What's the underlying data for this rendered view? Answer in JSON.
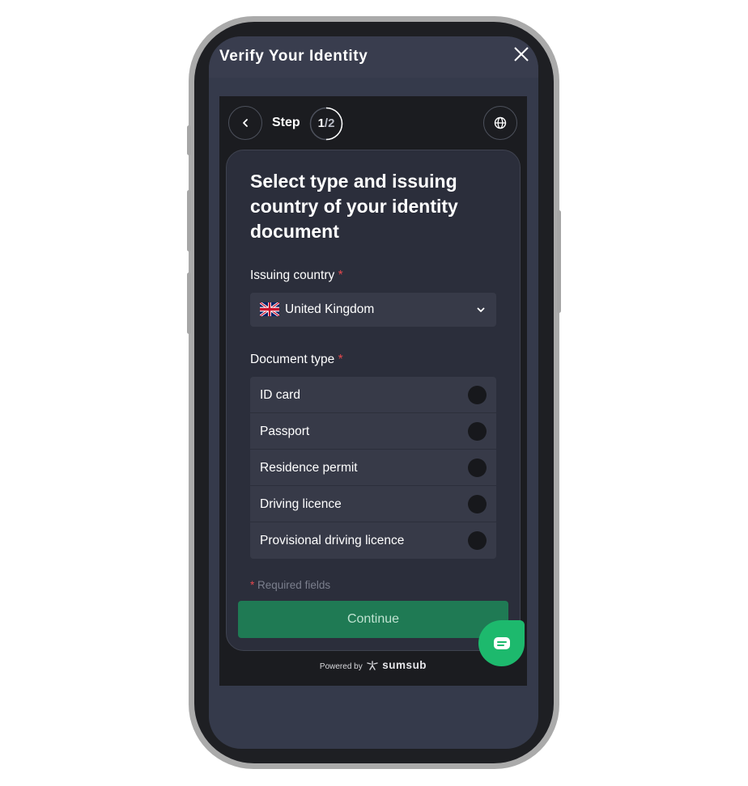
{
  "header": {
    "title": "Verify Your Identity",
    "close_icon": "close-icon"
  },
  "stepper": {
    "back_icon": "chevron-left-icon",
    "label": "Step",
    "current": "1",
    "total": "2",
    "progress": 0.5,
    "language_icon": "globe-icon"
  },
  "form": {
    "title": "Select type and issuing country of your identity document",
    "country_label": "Issuing country",
    "required_mark": "*",
    "country_value": "United Kingdom",
    "country_flag_icon": "uk-flag-icon",
    "dropdown_icon": "chevron-down-icon",
    "doc_type_label": "Document type",
    "doc_types": [
      {
        "label": "ID card",
        "selected": false
      },
      {
        "label": "Passport",
        "selected": false
      },
      {
        "label": "Residence permit",
        "selected": false
      },
      {
        "label": "Driving licence",
        "selected": false
      },
      {
        "label": "Provisional driving licence",
        "selected": false
      }
    ],
    "required_note": "Required fields",
    "continue_label": "Continue"
  },
  "footer": {
    "powered_by": "Powered by",
    "brand": "sumsub"
  },
  "chat": {
    "icon": "chat-icon"
  },
  "colors": {
    "primary_button": "#1f7a54",
    "chat_button": "#1db96d",
    "required": "#e5484d",
    "card_background": "#2b2e3b"
  }
}
